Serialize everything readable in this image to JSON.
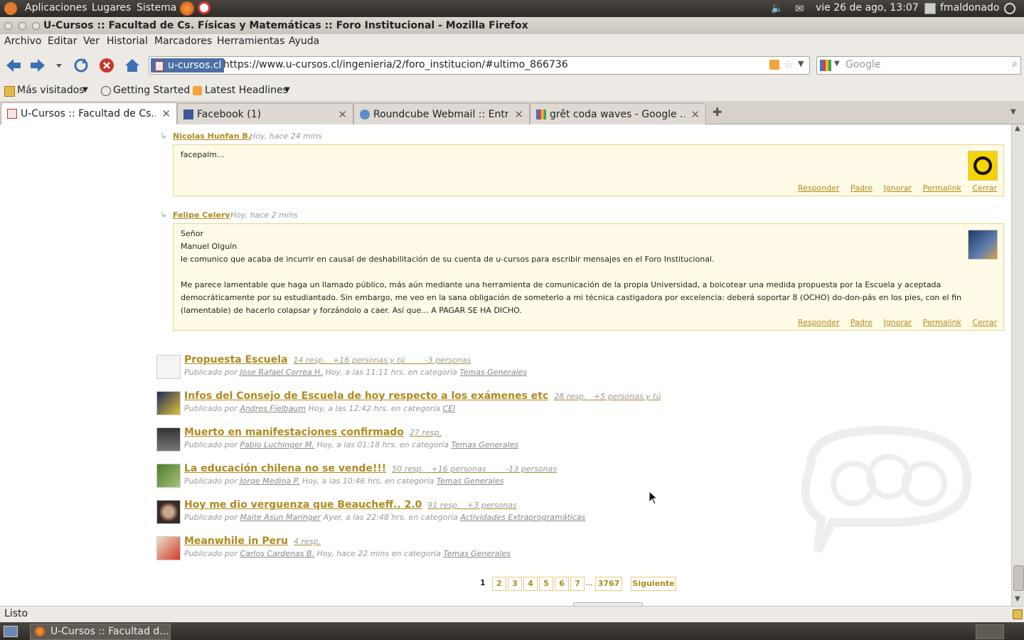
{
  "panel": {
    "menus": [
      "Aplicaciones",
      "Lugares",
      "Sistema"
    ],
    "datetime": "vie 26 de ago, 13:07",
    "user": "fmaldonado"
  },
  "window": {
    "title": "U-Cursos :: Facultad de Cs. Físicas y Matemáticas :: Foro Institucional - Mozilla Firefox"
  },
  "menubar": [
    "Archivo",
    "Editar",
    "Ver",
    "Historial",
    "Marcadores",
    "Herramientas",
    "Ayuda"
  ],
  "navbar": {
    "site_badge": "u-cursos.cl",
    "url": "https://www.u-cursos.cl/ingenieria/2/foro_institucion/#ultimo_866736",
    "search_placeholder": "Google"
  },
  "bookmarks": [
    "Más visitados",
    "Getting Started",
    "Latest Headlines"
  ],
  "tabs": [
    {
      "label": "U-Cursos :: Facultad de Cs....",
      "active": true
    },
    {
      "label": "Facebook (1)",
      "active": false
    },
    {
      "label": "Roundcube Webmail :: Entr...",
      "active": false
    },
    {
      "label": "grêt coda waves - Google ...",
      "active": false
    }
  ],
  "comments": [
    {
      "author": "Nicolas Hunfan B.",
      "time": "Hoy, hace 24 mins",
      "lines": [
        "facepalm..."
      ]
    },
    {
      "author": "Felipe Celery",
      "time": "Hoy, hace 2 mins",
      "lines": [
        "Señor",
        "Manuel Olguín",
        "le comunico que acaba de incurrir en causal de deshabilitación de su cuenta de u-cursos para escribir mensajes en el Foro Institucional.",
        "",
        "Me parece lamentable que haga un llamado público, más aún mediante una herramienta de comunicación de la propia Universidad, a boicotear una medida propuesta por la Escuela y aceptada democráticamente por su estudiantado. Sin embargo, me veo en la sana obligación de someterlo a mi técnica castigadora por excelencia: deberá soportar 8 (OCHO) do-don-pás en los pies, con el fin (lamentable) de hacerlo colapsar y forzándolo a caer. Así que... A PAGAR SE HA DICHO."
      ]
    }
  ],
  "comment_actions": [
    "Responder",
    "Padre",
    "Ignorar",
    "Permalink",
    "Cerrar"
  ],
  "threads": [
    {
      "title": "Propuesta Escuela",
      "stats": "14 resp.   +16 personas y tú        -3 personas",
      "by": "Jose Rafael Correa H.",
      "when": "Hoy, a las 11:11 hrs. en categoría",
      "cat": "Temas Generales"
    },
    {
      "title": "Infos del Consejo de Escuela de hoy respecto a los exámenes etc",
      "stats": "28 resp.   +5 personas y tú",
      "by": "Andres Fielbaum",
      "when": "Hoy, a las 12:42 hrs. en categoría",
      "cat": "CEI"
    },
    {
      "title": "Muerto en manifestaciones confirmado",
      "stats": "27 resp.",
      "by": "Pablo Luchinger M.",
      "when": "Hoy, a las 01:18 hrs. en categoría",
      "cat": "Temas Generales"
    },
    {
      "title": "La educación chilena no se vende!!!",
      "stats": "50 resp.   +16 personas        -13 personas",
      "by": "Jorge Medina P.",
      "when": "Hoy, a las 10:46 hrs. en categoría",
      "cat": "Temas Generales"
    },
    {
      "title": "Hoy me dio verguenza que Beaucheff.. 2.0",
      "stats": "91 resp.   +3 personas",
      "by": "Maite Asun Maringer",
      "when": "Ayer, a las 22:48 hrs. en categoría",
      "cat": "Actividades Extraprogramáticas"
    },
    {
      "title": "Meanwhile in Peru",
      "stats": "4 resp.",
      "by": "Carlos Cardenas B.",
      "when": "Hoy, hace 22 mins en categoría",
      "cat": "Temas Generales"
    }
  ],
  "published_by": "Publicado por",
  "pagination": {
    "current": "1",
    "pages": [
      "2",
      "3",
      "4",
      "5",
      "6",
      "7"
    ],
    "ellipsis": "...",
    "last": "3767",
    "next": "Siguiente"
  },
  "status": "Listo",
  "taskbar": {
    "task": "U-Cursos :: Facultad d..."
  }
}
